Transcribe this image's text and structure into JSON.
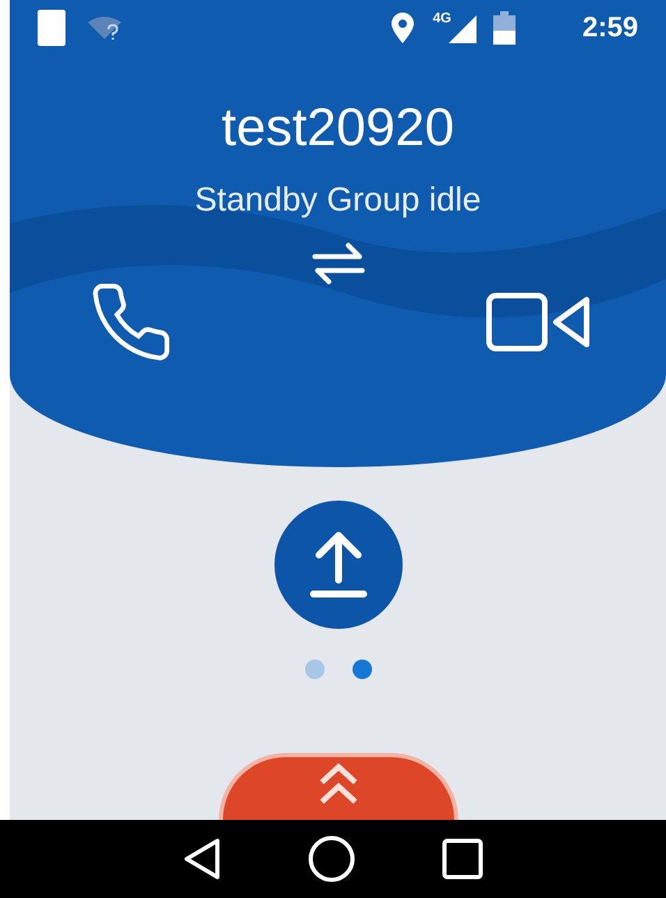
{
  "status_bar": {
    "time": "2:59",
    "network": "4G"
  },
  "header": {
    "title": "test20920",
    "subtitle": "Standby Group idle"
  },
  "pager": [
    {
      "selected": false
    },
    {
      "selected": true
    }
  ]
}
